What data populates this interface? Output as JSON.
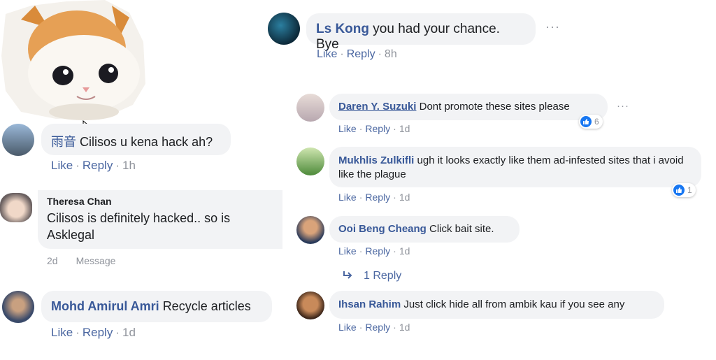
{
  "actions": {
    "like": "Like",
    "reply": "Reply",
    "message": "Message",
    "separator": "·"
  },
  "comments": [
    {
      "name": "Ls Kong",
      "text": "you had your chance. Bye",
      "time": "8h"
    },
    {
      "name": "Daren Y. Suzuki",
      "text": "Dont promote these sites please",
      "time": "1d",
      "reactions": "6"
    },
    {
      "name": "Mukhlis Zulkifli",
      "text": "ugh it looks exactly like them ad-infested sites that i avoid like the plague",
      "time": "1d",
      "reactions": "1"
    },
    {
      "name": "Ooi Beng Cheang",
      "text": "Click bait site.",
      "time": "1d",
      "replies": "1 Reply"
    },
    {
      "name": "Ihsan Rahim",
      "text": "Just click hide all from ambik kau if you see any",
      "time": "1d"
    },
    {
      "name": "雨音",
      "text": "Cilisos u kena hack ah?",
      "time": "1h"
    },
    {
      "name": "Theresa Chan",
      "text": "Cilisos is definitely hacked.. so is Asklegal",
      "time": "2d"
    },
    {
      "name": "Mohd Amirul Amri",
      "text": "Recycle articles",
      "time": "1d"
    }
  ],
  "icons": {
    "more": "more-options-icon",
    "like": "like-thumb-icon",
    "reply_arrow": "reply-arrow-icon",
    "cursor": "mouse-cursor-icon"
  },
  "colors": {
    "name": "#385898",
    "meta": "#90949c",
    "bubble": "#f2f3f5",
    "like_blue": "#1877f2"
  }
}
